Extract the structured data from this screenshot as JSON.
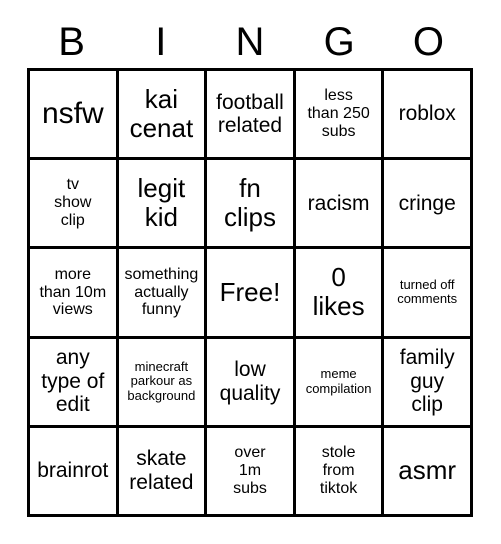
{
  "card": {
    "title": "BINGO",
    "header_letters": [
      "B",
      "I",
      "N",
      "G",
      "O"
    ],
    "free_space_label": "Free!",
    "colors": {
      "background": "#ffffff",
      "border": "#000000",
      "text": "#000000"
    },
    "grid": {
      "rows": 5,
      "columns": 5
    },
    "cells": [
      {
        "id": "b1",
        "column": "B",
        "row": 1,
        "text": "nsfw",
        "size": "xl",
        "free": false
      },
      {
        "id": "i1",
        "column": "I",
        "row": 1,
        "text": "kai\ncenat",
        "size": "lg",
        "free": false
      },
      {
        "id": "n1",
        "column": "N",
        "row": 1,
        "text": "football\nrelated",
        "size": "md",
        "free": false
      },
      {
        "id": "g1",
        "column": "G",
        "row": 1,
        "text": "less\nthan 250\nsubs",
        "size": "sm",
        "free": false
      },
      {
        "id": "o1",
        "column": "O",
        "row": 1,
        "text": "roblox",
        "size": "md",
        "free": false
      },
      {
        "id": "b2",
        "column": "B",
        "row": 2,
        "text": "tv\nshow\nclip",
        "size": "sm",
        "free": false
      },
      {
        "id": "i2",
        "column": "I",
        "row": 2,
        "text": "legit\nkid",
        "size": "lg",
        "free": false
      },
      {
        "id": "n2",
        "column": "N",
        "row": 2,
        "text": "fn\nclips",
        "size": "lg",
        "free": false
      },
      {
        "id": "g2",
        "column": "G",
        "row": 2,
        "text": "racism",
        "size": "md",
        "free": false
      },
      {
        "id": "o2",
        "column": "O",
        "row": 2,
        "text": "cringe",
        "size": "md",
        "free": false
      },
      {
        "id": "b3",
        "column": "B",
        "row": 3,
        "text": "more\nthan 10m\nviews",
        "size": "sm",
        "free": false
      },
      {
        "id": "i3",
        "column": "I",
        "row": 3,
        "text": "something\nactually\nfunny",
        "size": "sm",
        "free": false
      },
      {
        "id": "n3",
        "column": "N",
        "row": 3,
        "text": "Free!",
        "size": "lg",
        "free": true
      },
      {
        "id": "g3",
        "column": "G",
        "row": 3,
        "text": "0\nlikes",
        "size": "lg",
        "free": false
      },
      {
        "id": "o3",
        "column": "O",
        "row": 3,
        "text": "turned off\ncomments",
        "size": "xs",
        "free": false
      },
      {
        "id": "b4",
        "column": "B",
        "row": 4,
        "text": "any\ntype of\nedit",
        "size": "md",
        "free": false
      },
      {
        "id": "i4",
        "column": "I",
        "row": 4,
        "text": "minecraft\nparkour as\nbackground",
        "size": "xs",
        "free": false
      },
      {
        "id": "n4",
        "column": "N",
        "row": 4,
        "text": "low\nquality",
        "size": "md",
        "free": false
      },
      {
        "id": "g4",
        "column": "G",
        "row": 4,
        "text": "meme\ncompilation",
        "size": "xs",
        "free": false
      },
      {
        "id": "o4",
        "column": "O",
        "row": 4,
        "text": "family\nguy\nclip",
        "size": "md",
        "free": false
      },
      {
        "id": "b5",
        "column": "B",
        "row": 5,
        "text": "brainrot",
        "size": "md",
        "free": false
      },
      {
        "id": "i5",
        "column": "I",
        "row": 5,
        "text": "skate\nrelated",
        "size": "md",
        "free": false
      },
      {
        "id": "n5",
        "column": "N",
        "row": 5,
        "text": "over\n1m\nsubs",
        "size": "sm",
        "free": false
      },
      {
        "id": "g5",
        "column": "G",
        "row": 5,
        "text": "stole\nfrom\ntiktok",
        "size": "sm",
        "free": false
      },
      {
        "id": "o5",
        "column": "O",
        "row": 5,
        "text": "asmr",
        "size": "lg",
        "free": false
      }
    ]
  }
}
